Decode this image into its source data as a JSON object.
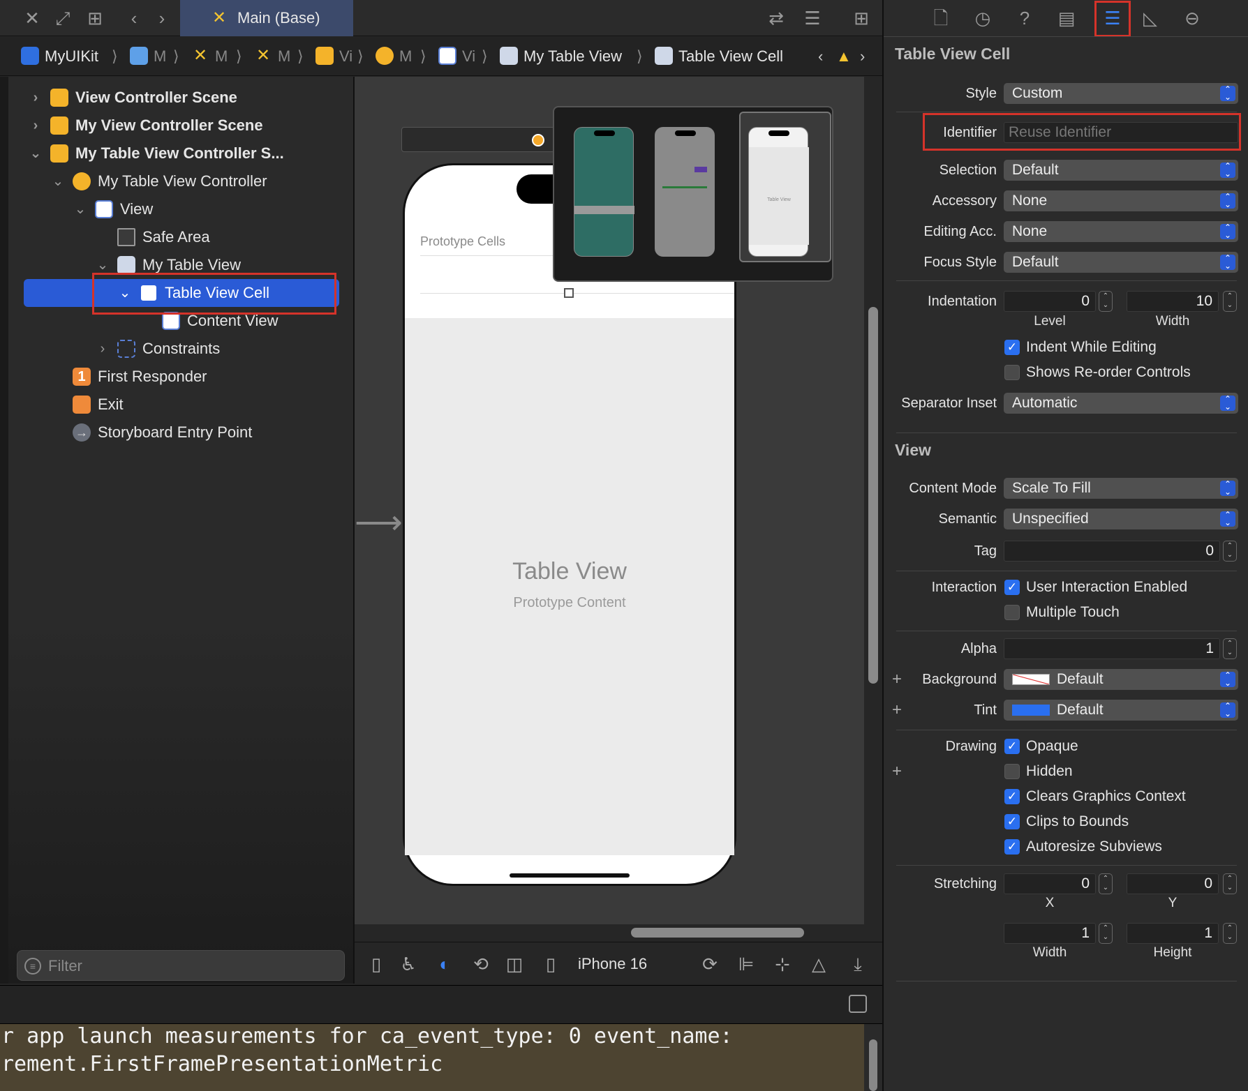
{
  "tabbar": {
    "main_tab": "Main (Base)"
  },
  "jumpbar": {
    "crumbs": [
      "MyUIKit",
      "M",
      "M",
      "M",
      "Vi",
      "M",
      "Vi",
      "My Table View",
      "Table View Cell"
    ]
  },
  "navigator": {
    "rows": [
      {
        "label": "View Controller Scene"
      },
      {
        "label": "My View Controller Scene"
      },
      {
        "label": "My Table View Controller S..."
      },
      {
        "label": "My Table View Controller"
      },
      {
        "label": "View"
      },
      {
        "label": "Safe Area"
      },
      {
        "label": "My Table View"
      },
      {
        "label": "Table View Cell"
      },
      {
        "label": "Content View"
      },
      {
        "label": "Constraints"
      },
      {
        "label": "First Responder"
      },
      {
        "label": "Exit"
      },
      {
        "label": "Storyboard Entry Point"
      }
    ],
    "first_responder_badge": "1",
    "filter_placeholder": "Filter"
  },
  "canvas": {
    "prototype_cells": "Prototype Cells",
    "table_view_title": "Table View",
    "table_view_subtitle": "Prototype Content",
    "thumbnail_texts": [
      "Table View"
    ],
    "device": "iPhone 16"
  },
  "console": {
    "lines": [
      "r app launch measurements for ca_event_type: 0 event_name:",
      "rement.FirstFramePresentationMetric"
    ]
  },
  "inspector": {
    "section_cell": "Table View Cell",
    "style_label": "Style",
    "style_value": "Custom",
    "identifier_label": "Identifier",
    "identifier_placeholder": "Reuse Identifier",
    "selection_label": "Selection",
    "selection_value": "Default",
    "accessory_label": "Accessory",
    "accessory_value": "None",
    "editing_acc_label": "Editing Acc.",
    "editing_acc_value": "None",
    "focus_style_label": "Focus Style",
    "focus_style_value": "Default",
    "indentation_label": "Indentation",
    "indent_level": "0",
    "indent_width": "10",
    "level_label": "Level",
    "width_label": "Width",
    "indent_while_editing": "Indent While Editing",
    "shows_reorder": "Shows Re-order Controls",
    "separator_inset_label": "Separator Inset",
    "separator_inset_value": "Automatic",
    "section_view": "View",
    "content_mode_label": "Content Mode",
    "content_mode_value": "Scale To Fill",
    "semantic_label": "Semantic",
    "semantic_value": "Unspecified",
    "tag_label": "Tag",
    "tag_value": "0",
    "interaction_label": "Interaction",
    "user_interaction": "User Interaction Enabled",
    "multiple_touch": "Multiple Touch",
    "alpha_label": "Alpha",
    "alpha_value": "1",
    "background_label": "Background",
    "background_value": "Default",
    "tint_label": "Tint",
    "tint_value": "Default",
    "drawing_label": "Drawing",
    "opaque": "Opaque",
    "hidden": "Hidden",
    "clears_graphics": "Clears Graphics Context",
    "clips_to_bounds": "Clips to Bounds",
    "autoresize_subviews": "Autoresize Subviews",
    "stretching_label": "Stretching",
    "stretch_x": "0",
    "stretch_y": "0",
    "stretch_w": "1",
    "stretch_h": "1",
    "x_label": "X",
    "y_label": "Y",
    "width_label2": "Width",
    "height_label": "Height"
  },
  "colors": {
    "selection": "#2a5bd6",
    "highlight": "#d5332a",
    "accent": "#3b82f6",
    "tint_swatch": "#2a6ff0"
  }
}
